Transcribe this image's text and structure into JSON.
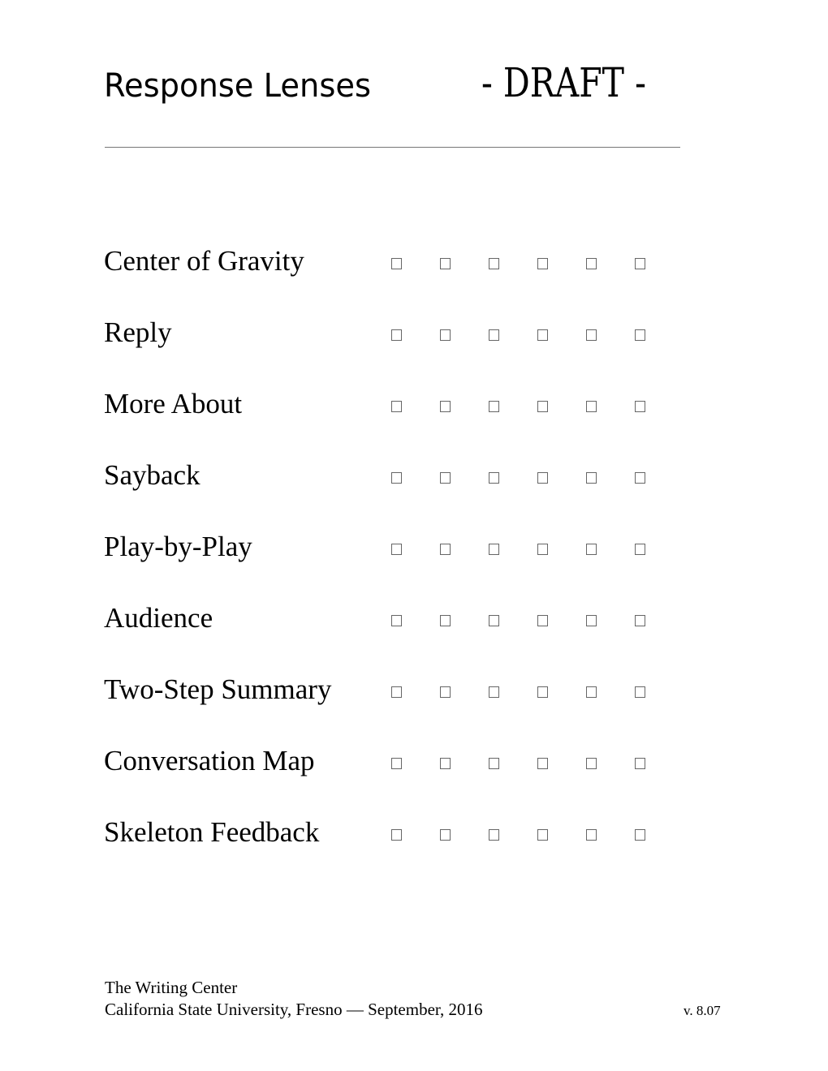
{
  "header": {
    "title": "Response Lenses",
    "draft_label": "- DRAFT -"
  },
  "lenses": [
    {
      "label": "Center of Gravity",
      "checks": [
        false,
        false,
        false,
        false,
        false,
        false
      ]
    },
    {
      "label": "Reply",
      "checks": [
        false,
        false,
        false,
        false,
        false,
        false
      ]
    },
    {
      "label": "More About",
      "checks": [
        false,
        false,
        false,
        false,
        false,
        false
      ]
    },
    {
      "label": "Sayback",
      "checks": [
        false,
        false,
        false,
        false,
        false,
        false
      ]
    },
    {
      "label": "Play-by-Play",
      "checks": [
        false,
        false,
        false,
        false,
        false,
        false
      ]
    },
    {
      "label": "Audience",
      "checks": [
        false,
        false,
        false,
        false,
        false,
        false
      ]
    },
    {
      "label": "Two-Step Summary",
      "checks": [
        false,
        false,
        false,
        false,
        false,
        false
      ]
    },
    {
      "label": "Conversation Map",
      "checks": [
        false,
        false,
        false,
        false,
        false,
        false
      ]
    },
    {
      "label": "Skeleton Feedback",
      "checks": [
        false,
        false,
        false,
        false,
        false,
        false
      ]
    }
  ],
  "checkbox_icon": "empty-square",
  "footer": {
    "organization": "The Writing Center",
    "institution_date": "California State University, Fresno — September, 2016",
    "version": "v. 8.07"
  }
}
